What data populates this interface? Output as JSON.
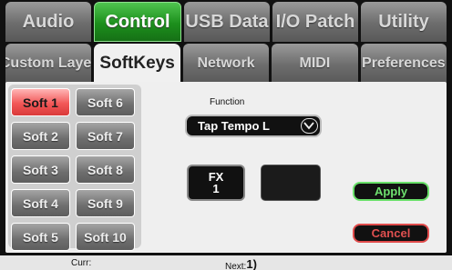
{
  "tabs_top": [
    {
      "label": "Audio",
      "active": false
    },
    {
      "label": "Control",
      "active": true
    },
    {
      "label": "USB Data",
      "active": false
    },
    {
      "label": "I/O Patch",
      "active": false
    },
    {
      "label": "Utility",
      "active": false
    }
  ],
  "tabs_second": [
    {
      "label": "Custom Layer",
      "active": false
    },
    {
      "label": "SoftKeys",
      "active": true
    },
    {
      "label": "Network",
      "active": false
    },
    {
      "label": "MIDI",
      "active": false
    },
    {
      "label": "Preferences",
      "active": false
    }
  ],
  "softkeys": [
    {
      "label": "Soft 1",
      "selected": true
    },
    {
      "label": "Soft 6",
      "selected": false
    },
    {
      "label": "Soft 2",
      "selected": false
    },
    {
      "label": "Soft 7",
      "selected": false
    },
    {
      "label": "Soft 3",
      "selected": false
    },
    {
      "label": "Soft 8",
      "selected": false
    },
    {
      "label": "Soft 4",
      "selected": false
    },
    {
      "label": "Soft 9",
      "selected": false
    },
    {
      "label": "Soft 5",
      "selected": false
    },
    {
      "label": "Soft 10",
      "selected": false
    }
  ],
  "function": {
    "label": "Function",
    "value": "Tap Tempo L",
    "dropdown_icon": "chevron-down-icon"
  },
  "fx": {
    "line1": "FX",
    "line2": "1"
  },
  "buttons": {
    "apply": "Apply",
    "cancel": "Cancel"
  },
  "status": {
    "curr_label": "Curr:",
    "next_label": "Next:",
    "next_value": "1)"
  },
  "colors": {
    "active_tab": "#1c8f1c",
    "selected_key": "#f25757",
    "apply": "#6fe06f",
    "cancel": "#e05050"
  }
}
